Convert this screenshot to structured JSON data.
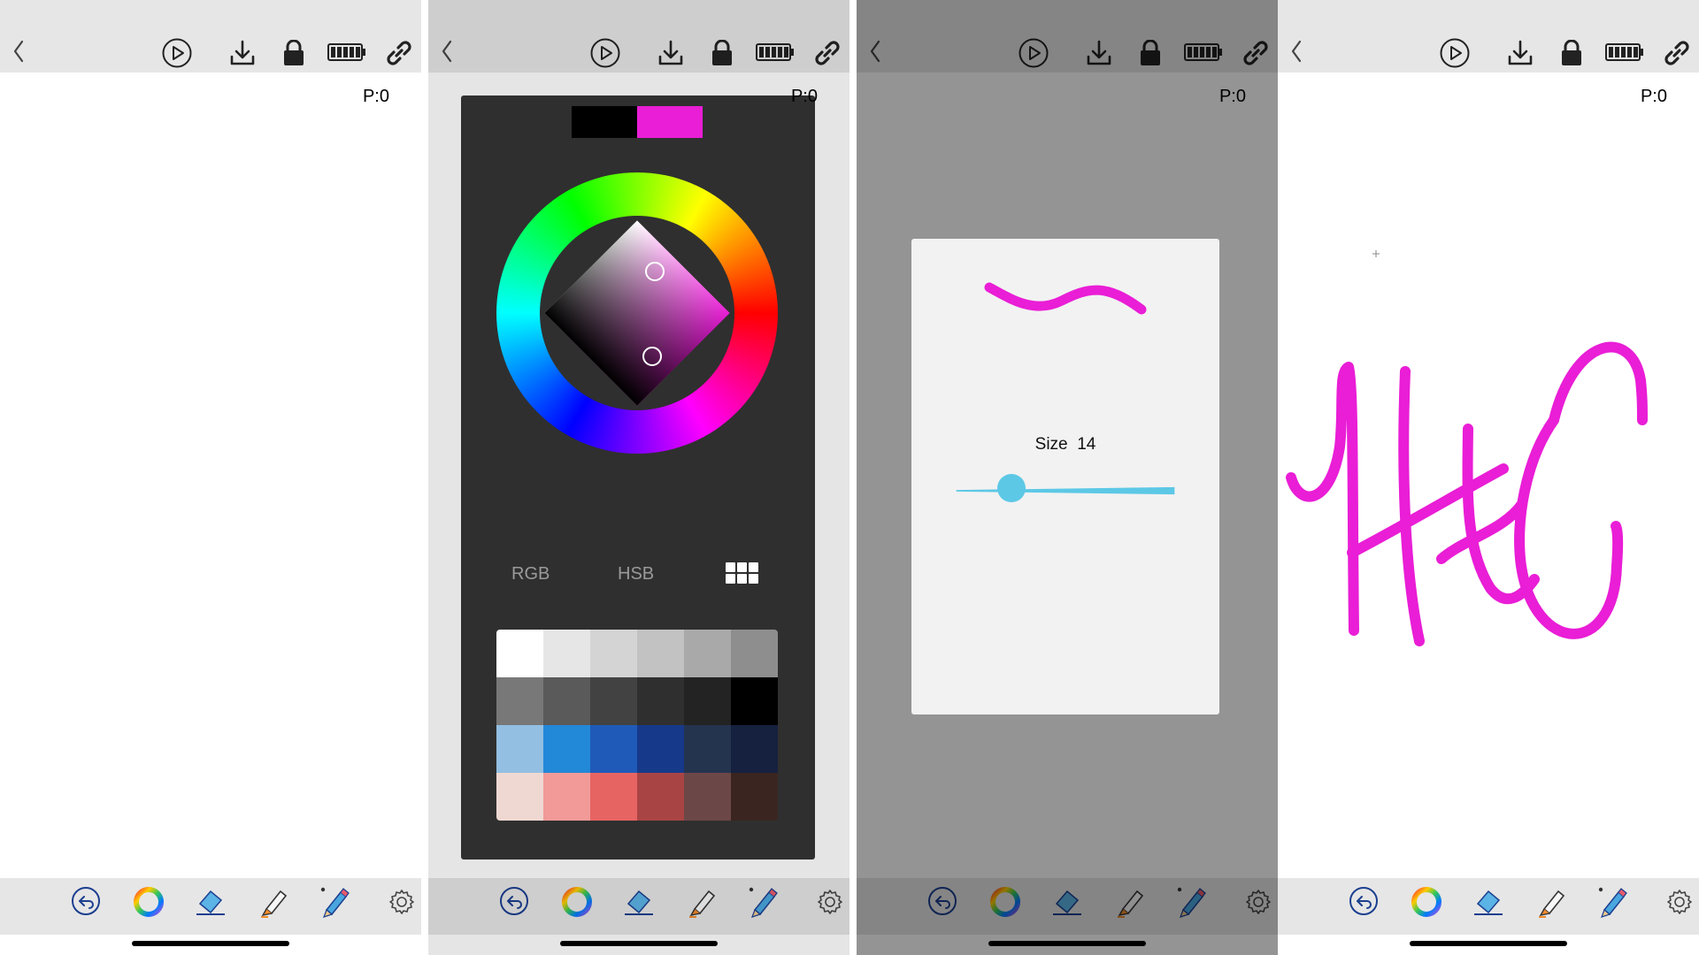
{
  "toolbar": {
    "back": "back-icon",
    "play": "play-icon",
    "download": "download-icon",
    "lock": "lock-icon",
    "battery": "battery-icon",
    "link": "link-icon"
  },
  "bottom_tools": [
    "undo-icon",
    "color-wheel-icon",
    "eraser-icon",
    "marker-icon",
    "pencil-icon",
    "gear-icon"
  ],
  "panels": [
    {
      "point_count": "P:0"
    },
    {
      "point_count": "P:0",
      "color_picker": {
        "previous_color": "#000000",
        "current_color": "#e91ed6",
        "modes": [
          "RGB",
          "HSB"
        ],
        "grid_mode_icon": "grid-icon",
        "palette": [
          "#ffffff",
          "#e6e6e6",
          "#d4d4d4",
          "#c2c2c2",
          "#a9a9a9",
          "#8e8e8e",
          "#787878",
          "#5a5a5a",
          "#424242",
          "#2f2f2f",
          "#232323",
          "#000000",
          "#93bfe3",
          "#2288d8",
          "#1f5ab8",
          "#17398a",
          "#24344f",
          "#15213f",
          "#efd8d2",
          "#f19a98",
          "#e66462",
          "#a94444",
          "#6c4747",
          "#3a2520"
        ]
      }
    },
    {
      "point_count": "P:0",
      "brush_size": {
        "label": "Size",
        "value": "14",
        "slider_fraction": 0.3,
        "preview_color": "#e91ed6"
      }
    },
    {
      "point_count": "P:0",
      "drawing_color": "#e91ed6"
    }
  ],
  "colors": {
    "accent": "#e91ed6",
    "slider": "#5cc8e6",
    "bar_bg": "#e6e6e6",
    "icon_blue": "#1b3f8f"
  }
}
